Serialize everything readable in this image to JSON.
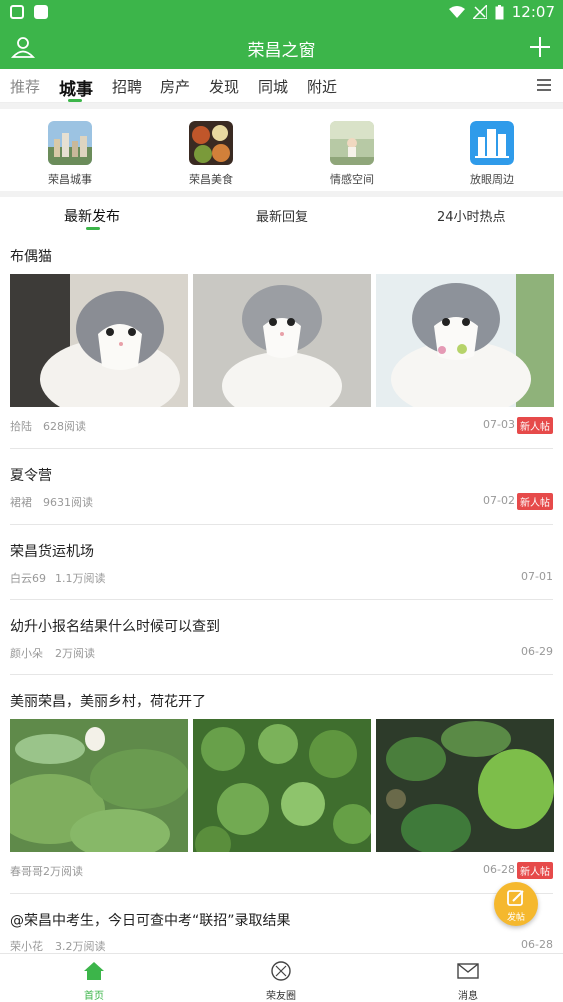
{
  "status_bar": {
    "time": "12:07"
  },
  "app_bar": {
    "title": "荣昌之窗"
  },
  "tabs": [
    {
      "label": "推荐"
    },
    {
      "label": "城事"
    },
    {
      "label": "招聘"
    },
    {
      "label": "房产"
    },
    {
      "label": "发现"
    },
    {
      "label": "同城"
    },
    {
      "label": "附近"
    }
  ],
  "categories": [
    {
      "label": "荣昌城事",
      "icon": "city-photo-icon"
    },
    {
      "label": "荣昌美食",
      "icon": "food-photo-icon"
    },
    {
      "label": "情感空间",
      "icon": "emotion-photo-icon"
    },
    {
      "label": "放眼周边",
      "icon": "buildings-icon"
    }
  ],
  "sub_tabs": [
    {
      "label": "最新发布"
    },
    {
      "label": "最新回复"
    },
    {
      "label": "24小时热点"
    }
  ],
  "posts": [
    {
      "title": "布偶猫",
      "author": "拾陆",
      "reads": "628阅读",
      "date": "07-03",
      "badge": "新人帖"
    },
    {
      "title": "夏令营",
      "author": "裙裙",
      "reads": "9631阅读",
      "date": "07-02",
      "badge": "新人帖"
    },
    {
      "title": "荣昌货运机场",
      "author": "白云69",
      "reads": "1.1万阅读",
      "date": "07-01",
      "badge": ""
    },
    {
      "title": "幼升小报名结果什么时候可以查到",
      "author": "颜小朵",
      "reads": "2万阅读",
      "date": "06-29",
      "badge": ""
    },
    {
      "title": "美丽荣昌，美丽乡村，荷花开了",
      "author": "春哥哥",
      "reads": "2万阅读",
      "date": "06-28",
      "badge": "新人帖"
    },
    {
      "title": "@荣昌中考生，今日可查中考“联招”录取结果",
      "author": "荣小花",
      "reads": "3.2万阅读",
      "date": "06-28",
      "badge": ""
    }
  ],
  "fab": {
    "label": "发帖"
  },
  "bottom_nav": [
    {
      "label": "首页"
    },
    {
      "label": "荣友圈"
    },
    {
      "label": "消息"
    }
  ],
  "colors": {
    "brand": "#3cb54a",
    "badge": "#e64a4a",
    "fab": "#f5b82e"
  }
}
